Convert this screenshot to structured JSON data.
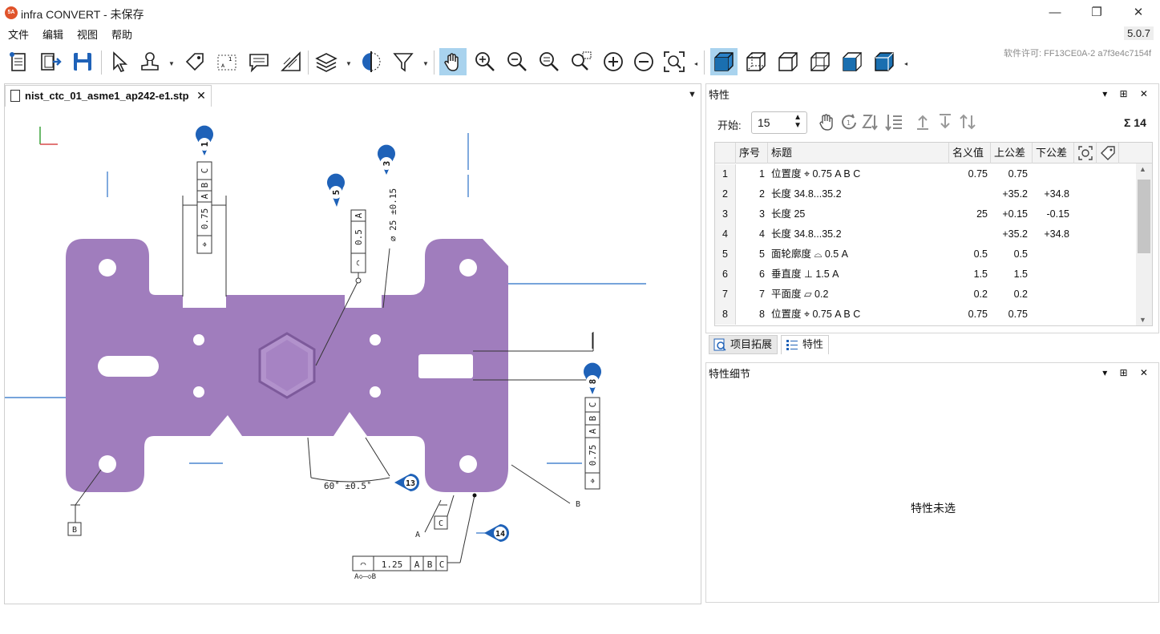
{
  "window": {
    "title": "infra CONVERT - 未保存",
    "logo_text": "5A",
    "minimize": "—",
    "maximize": "❐",
    "close": "✕"
  },
  "menu": {
    "items": [
      "文件",
      "编辑",
      "视图",
      "帮助"
    ],
    "version": "5.0.7",
    "license": "软件许可: FF13CE0A-2 a7f3e4c7154f"
  },
  "toolbar": {
    "icons": [
      "new-document-icon",
      "export-icon",
      "save-icon",
      "select-cursor-icon",
      "stamp-icon",
      "tag-icon",
      "zoom-region-icon",
      "comment-icon",
      "measure-icon",
      "layers-icon",
      "section-icon",
      "filter-icon",
      "pan-hand-icon",
      "zoom-in-icon",
      "zoom-out-icon",
      "zoom-fit-icon",
      "zoom-window-icon",
      "plus-icon",
      "minus-icon",
      "zoom-all-icon",
      "cube-shaded-icon",
      "cube-wire-icon",
      "cube-hidden-icon",
      "cube-outline-icon",
      "cube-solid-icon",
      "cube-blue-icon"
    ]
  },
  "document": {
    "tab_label": "nist_ctc_01_asme1_ap242-e1.stp",
    "tab_close": "✕",
    "menu_arrow": "▼"
  },
  "drawing": {
    "balloons": [
      "1",
      "3",
      "5",
      "8",
      "13",
      "14"
    ],
    "fcf_1": [
      "⌖",
      "0.75",
      "A",
      "B",
      "C"
    ],
    "fcf_5": [
      "◠",
      "0.5",
      "A"
    ],
    "dim_3": "⌀ 25 ±0.15",
    "fcf_8": [
      "⌖",
      "0.75",
      "A",
      "B",
      "C"
    ],
    "angle_13": "60˚ ±0.5˚",
    "fcf_14": [
      "◠",
      "1.25",
      "A",
      "B",
      "C"
    ],
    "fcf_14_sub": "A◇—◇B",
    "datum_b": "B",
    "datum_c": "C",
    "label_a": "A",
    "label_b_right": "B",
    "colors": {
      "part": "#a07dbd",
      "balloon": "#1f62b8",
      "leader": "#333333",
      "axis_blue": "#4a86cf"
    }
  },
  "properties": {
    "title": "特性",
    "start_label": "开始:",
    "start_value": "15",
    "sigma": "Σ 14",
    "columns": [
      "序号",
      "标题",
      "名义值",
      "上公差",
      "下公差"
    ],
    "rows": [
      {
        "n": "1",
        "seq": "1",
        "title": "位置度 ⌖ 0.75 A B C",
        "nominal": "0.75",
        "upper": "0.75",
        "lower": ""
      },
      {
        "n": "2",
        "seq": "2",
        "title": "长度 34.8...35.2",
        "nominal": "",
        "upper": "+35.2",
        "lower": "+34.8"
      },
      {
        "n": "3",
        "seq": "3",
        "title": "长度 25",
        "nominal": "25",
        "upper": "+0.15",
        "lower": "-0.15"
      },
      {
        "n": "4",
        "seq": "4",
        "title": "长度 34.8...35.2",
        "nominal": "",
        "upper": "+35.2",
        "lower": "+34.8"
      },
      {
        "n": "5",
        "seq": "5",
        "title": "面轮廓度 ⌓ 0.5 A",
        "nominal": "0.5",
        "upper": "0.5",
        "lower": ""
      },
      {
        "n": "6",
        "seq": "6",
        "title": "垂直度 ⊥ 1.5 A",
        "nominal": "1.5",
        "upper": "1.5",
        "lower": ""
      },
      {
        "n": "7",
        "seq": "7",
        "title": "平面度 ▱ 0.2",
        "nominal": "0.2",
        "upper": "0.2",
        "lower": ""
      },
      {
        "n": "8",
        "seq": "8",
        "title": "位置度 ⌖ 0.75 A B C",
        "nominal": "0.75",
        "upper": "0.75",
        "lower": ""
      }
    ]
  },
  "bottom_tabs": {
    "project": "项目拓展",
    "properties": "特性"
  },
  "details": {
    "title": "特性细节",
    "empty_message": "特性未选"
  },
  "panel_controls": "▾ ⊞ ✕"
}
